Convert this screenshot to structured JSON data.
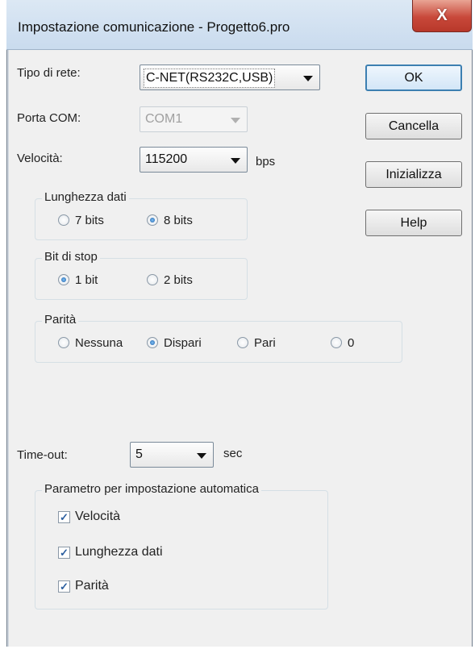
{
  "window": {
    "title": "Impostazione comunicazione - Progetto6.pro",
    "close_glyph": "X"
  },
  "network": {
    "label": "Tipo di rete:",
    "value": "C-NET(RS232C,USB)"
  },
  "com_port": {
    "label": "Porta COM:",
    "value": "COM1",
    "enabled": false
  },
  "speed": {
    "label": "Velocità:",
    "value": "115200",
    "unit": "bps"
  },
  "data_length": {
    "title": "Lunghezza dati",
    "options": [
      "7 bits",
      "8 bits"
    ],
    "selected": "8 bits"
  },
  "stop_bit": {
    "title": "Bit di stop",
    "options": [
      "1 bit",
      "2 bits"
    ],
    "selected": "1 bit"
  },
  "parity": {
    "title": "Parità",
    "options": [
      "Nessuna",
      "Dispari",
      "Pari",
      "0"
    ],
    "selected": "Dispari"
  },
  "timeout": {
    "label": "Time-out:",
    "value": "5",
    "unit": "sec"
  },
  "auto_params": {
    "title": "Parametro per impostazione automatica",
    "items": [
      {
        "label": "Velocità",
        "checked": true,
        "mark": "✓"
      },
      {
        "label": "Lunghezza dati",
        "checked": true,
        "mark": "✓"
      },
      {
        "label": "Parità",
        "checked": true,
        "mark": "✓"
      }
    ]
  },
  "buttons": {
    "ok": "OK",
    "cancel": "Cancella",
    "initialize": "Inizializza",
    "help": "Help"
  },
  "colors": {
    "accent": "#3c7fb1",
    "close": "#c8483a",
    "radio_on": "#1d5fa8"
  }
}
